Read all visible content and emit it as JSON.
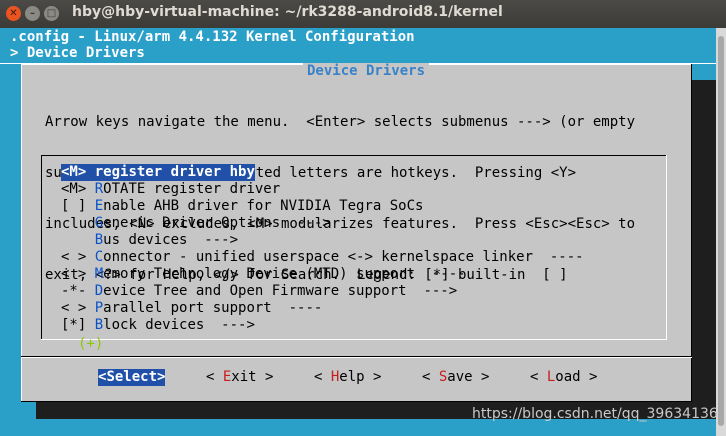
{
  "window": {
    "title": "hby@hby-virtual-machine: ~/rk3288-android8.1/kernel",
    "buttons": [
      "close-icon",
      "minimize-icon",
      "maximize-icon"
    ]
  },
  "header": {
    "config_line": ".config - Linux/arm 4.4.132 Kernel Configuration",
    "breadcrumb": "> Device Drivers"
  },
  "dialog": {
    "title": "Device Drivers",
    "help_lines": [
      "Arrow keys navigate the menu.  <Enter> selects submenus ---> (or empty",
      "submenus ----).  Highlighted letters are hotkeys.  Pressing <Y>",
      "includes, <N> excludes, <M> modularizes features.  Press <Esc><Esc> to",
      "exit, <?> for Help, </> for Search.  Legend: [*] built-in  [ ]"
    ],
    "items": [
      {
        "prefix": "<M> ",
        "hotkey": "r",
        "rest": "egister driver hby",
        "selected": true
      },
      {
        "prefix": "<M> ",
        "hotkey": "R",
        "rest": "OTATE register driver",
        "selected": false
      },
      {
        "prefix": "[ ] ",
        "hotkey": "E",
        "rest": "nable AHB driver for NVIDIA Tegra SoCs",
        "selected": false
      },
      {
        "prefix": "    ",
        "hotkey": "G",
        "rest": "eneric Driver Options  --->",
        "selected": false
      },
      {
        "prefix": "    ",
        "hotkey": "B",
        "rest": "us devices  --->",
        "selected": false
      },
      {
        "prefix": "< > ",
        "hotkey": "C",
        "rest": "onnector - unified userspace <-> kernelspace linker  ----",
        "selected": false
      },
      {
        "prefix": "< > ",
        "hotkey": "M",
        "rest": "emory Technology Device (MTD) support  ----",
        "selected": false
      },
      {
        "prefix": "-*- ",
        "hotkey": "D",
        "rest": "evice Tree and Open Firmware support  --->",
        "selected": false
      },
      {
        "prefix": "< > ",
        "hotkey": "P",
        "rest": "arallel port support  ----",
        "selected": false
      },
      {
        "prefix": "[*] ",
        "hotkey": "B",
        "rest": "lock devices  --->",
        "selected": false
      }
    ],
    "more_indicator": "(+)",
    "buttons": [
      {
        "l": "<",
        "hotkey": "S",
        "rest": "elect",
        "r": ">",
        "selected": true
      },
      {
        "l": "< ",
        "hotkey": "E",
        "rest": "xit",
        "r": " >",
        "selected": false
      },
      {
        "l": "< ",
        "hotkey": "H",
        "rest": "elp",
        "r": " >",
        "selected": false
      },
      {
        "l": "< ",
        "hotkey": "S",
        "rest": "ave",
        "r": " >",
        "selected": false
      },
      {
        "l": "< ",
        "hotkey": "L",
        "rest": "oad",
        "r": " >",
        "selected": false
      }
    ]
  },
  "watermark": "https://blog.csdn.net/qq_39634136"
}
